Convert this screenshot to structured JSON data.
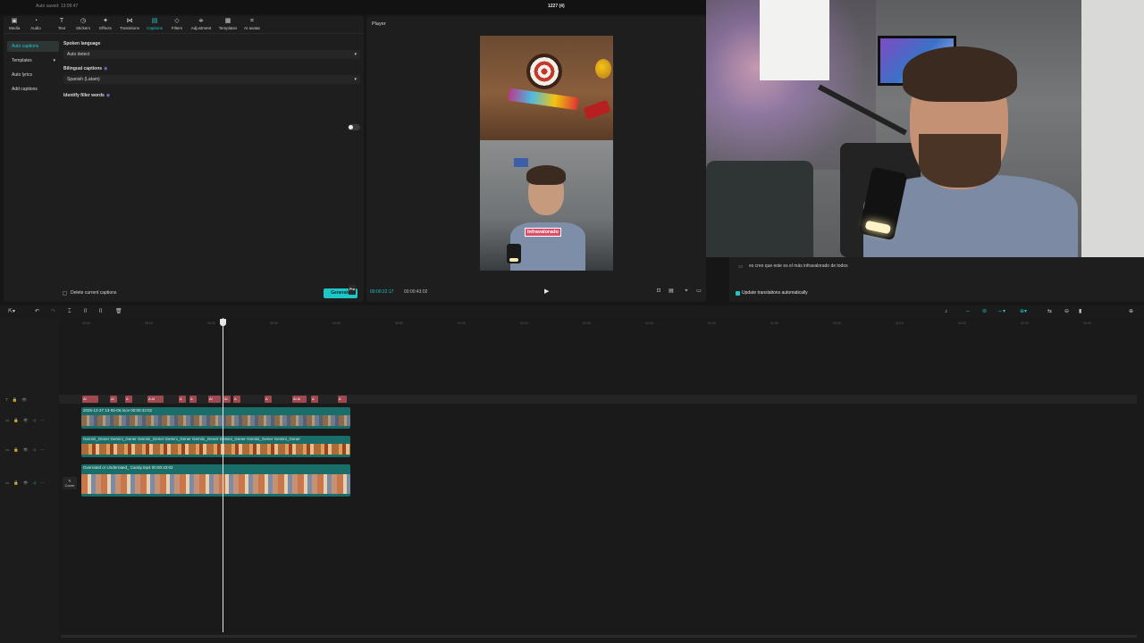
{
  "titlebar": {
    "autosave": "Auto saved: 13:09:47",
    "project": "1227 (4)"
  },
  "toolbar": {
    "items": [
      {
        "label": "Media",
        "icon": "media-icon"
      },
      {
        "label": "Audio",
        "icon": "audio-icon"
      },
      {
        "label": "Text",
        "icon": "text-icon"
      },
      {
        "label": "Stickers",
        "icon": "stickers-icon"
      },
      {
        "label": "Effects",
        "icon": "effects-icon"
      },
      {
        "label": "Transitions",
        "icon": "transitions-icon"
      },
      {
        "label": "Captions",
        "icon": "captions-icon"
      },
      {
        "label": "Filters",
        "icon": "filters-icon"
      },
      {
        "label": "Adjustment",
        "icon": "adjustment-icon"
      },
      {
        "label": "Templates",
        "icon": "templates-icon"
      },
      {
        "label": "AI avatar",
        "icon": "ai-avatar-icon"
      }
    ],
    "active": "Captions"
  },
  "side_nav": {
    "items": [
      "Auto captions",
      "Templates",
      "Auto lyrics",
      "Add captions"
    ],
    "active": "Auto captions"
  },
  "caption_settings": {
    "spoken_language_label": "Spoken language",
    "spoken_language_value": "Auto detect",
    "bilingual_label": "Bilingual captions",
    "bilingual_value": "Spanish (Latam)",
    "filler_label": "Identify filler words",
    "filler_enabled": false,
    "delete_current_label": "Delete current captions",
    "generate_label": "Generate",
    "pro_tag": "Pro"
  },
  "player": {
    "title": "Player",
    "caption_overlay": "Infravalorado",
    "current_time": "00:00:22:17",
    "total_time": "00:00:43:02"
  },
  "translation": {
    "line_number": "33",
    "line_text": "es creo que este es el más infravalorado de todos",
    "auto_update_label": "Update translations automatically"
  },
  "timeline": {
    "ruler_ticks": [
      "00:00",
      "00:10",
      "00:20",
      "00:30",
      "00:40",
      "00:50",
      "01:00",
      "01:10",
      "01:20",
      "01:30",
      "01:40",
      "01:50",
      "02:00",
      "02:10",
      "02:20",
      "02:30",
      "02:40"
    ],
    "caption_segments": [
      "Al",
      "Al",
      "A",
      "A Al",
      "A",
      "A",
      "Al",
      "Al",
      "A",
      "A",
      "Al Al",
      "A",
      "A"
    ],
    "clips": {
      "main_label": "2025-12-27 13-06-06.mov  00:00:43:02",
      "gemini_label": "Gemini_Gener  Gemini_Gener  Gemini_Gener  Gemini_Gener  Gemini_Gener  Gemini_Gener  Gemini_Gener  Gemini_Gener",
      "video_label": "Overrated or Underrated_ Candy.mp4  00:00:43:02"
    },
    "cover_label": "Cover"
  },
  "colors": {
    "accent": "#1ec6c6",
    "caption_clip": "#a04850",
    "video_clip": "#1a6e69"
  }
}
